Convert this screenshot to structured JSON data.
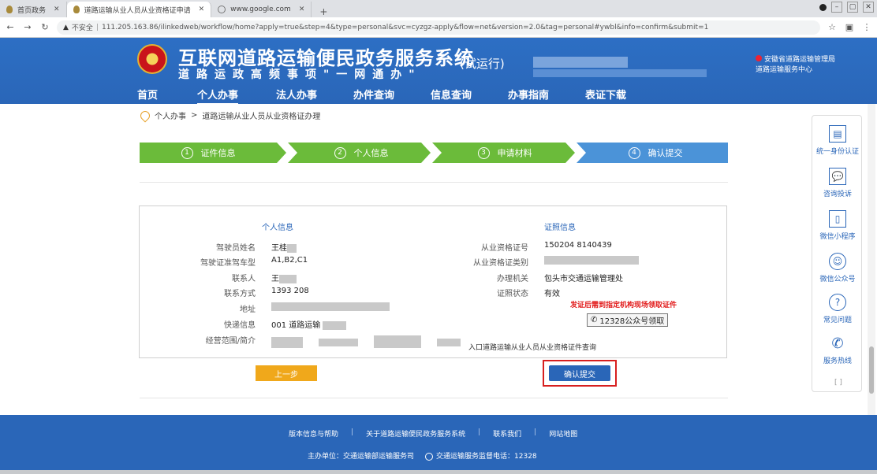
{
  "browser": {
    "tabs": [
      {
        "label": "首页政务",
        "active": false
      },
      {
        "label": "道路运输从业人员从业资格证申请",
        "active": true
      },
      {
        "label": "www.google.com",
        "active": false
      }
    ],
    "new_tab": "+",
    "url_prefix": "不安全",
    "url": "111.205.163.86/ilinkedweb/workflow/home?apply=true&step=4&type=personal&svc=cyzgz-apply&flow=net&version=2.0&tag=personal#ywbl&info=confirm&submit=1"
  },
  "site": {
    "title": "互联网道路运输便民政务服务系统",
    "trial": "(试运行)",
    "subtitle": "道路运政高频事项\"一网通办\"",
    "notice_right_line1": "安徽省道路运输管理局",
    "notice_right_line2": "道路运输服务中心",
    "brand_color": "#2a66b8",
    "nav": [
      {
        "label": "首页"
      },
      {
        "label": "个人办事"
      },
      {
        "label": "法人办事"
      },
      {
        "label": "办件查询"
      },
      {
        "label": "信息查询"
      },
      {
        "label": "办事指南"
      },
      {
        "label": "表证下载"
      }
    ]
  },
  "breadcrumb": {
    "items": [
      "个人办事",
      "道路运输从业人员从业资格证办理"
    ],
    "separator": ">"
  },
  "steps": [
    {
      "num": "1",
      "label": "证件信息",
      "color": "#6bbb3a"
    },
    {
      "num": "2",
      "label": "个人信息",
      "color": "#6bbb3a"
    },
    {
      "num": "3",
      "label": "申请材料",
      "color": "#6bbb3a"
    },
    {
      "num": "4",
      "label": "确认提交",
      "color": "#4b93d8"
    }
  ],
  "personal": {
    "title": "个人信息",
    "rows": [
      {
        "label": "驾驶员姓名",
        "value": "王桂"
      },
      {
        "label": "驾驶证准驾车型",
        "value": "A1,B2,C1"
      },
      {
        "label": "联系人",
        "value": "王"
      },
      {
        "label": "联系方式",
        "value": "1393  208"
      },
      {
        "label": "地址",
        "value": ""
      },
      {
        "label": "快递信息",
        "value": "001 道路运输"
      },
      {
        "label": "经营范围/简介",
        "value": ""
      }
    ]
  },
  "application": {
    "title": "证照信息",
    "rows": [
      {
        "label": "从业资格证号",
        "value": "150204  8140439"
      },
      {
        "label": "从业资格证类别",
        "value": ""
      },
      {
        "label": "办理机关",
        "value": "包头市交通运输管理处"
      },
      {
        "label": "证照状态",
        "value": "有效"
      }
    ],
    "notice": "发证后需到指定机构现场领取证件",
    "phone_icon": "phone-icon",
    "phone": "12328公众号领取"
  },
  "signature_note": "入口道路运输从业人员从业资格证件查询",
  "buttons": {
    "prev": "上一步",
    "submit": "确认提交",
    "prev_color": "#f0a81b",
    "submit_color": "#2a66b8",
    "highlight_color": "#d71f1f"
  },
  "side_panel": [
    {
      "icon": "form-icon",
      "glyph": "▤",
      "label": "统一身份认证"
    },
    {
      "icon": "chat-icon",
      "glyph": "💬",
      "label": "咨询投诉"
    },
    {
      "icon": "phone-app-icon",
      "glyph": "▯",
      "label": "微信小程序"
    },
    {
      "icon": "wechat-icon",
      "glyph": "☺",
      "label": "微信公众号"
    },
    {
      "icon": "help-icon",
      "glyph": "?",
      "label": "常见问题"
    },
    {
      "icon": "call-icon",
      "glyph": "✆",
      "label": "服务热线"
    }
  ],
  "side_close": "[ ]",
  "footer": {
    "links": [
      "版本信息与帮助",
      "关于道路运输便民政务服务系统",
      "联系我们",
      "网站地图"
    ],
    "separator": "|",
    "host": "主办单位：交通运输部运输服务司",
    "hotline": "交通运输服务监督电话：12328"
  }
}
